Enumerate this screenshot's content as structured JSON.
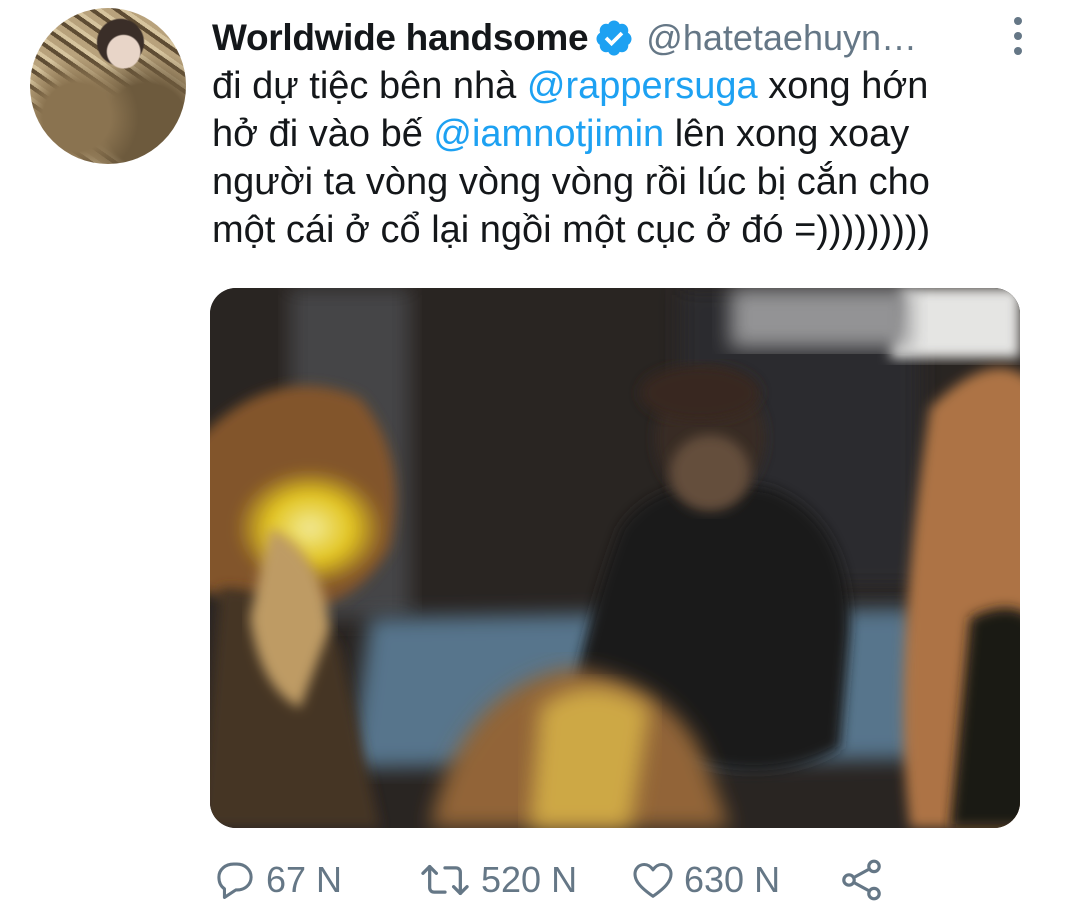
{
  "tweet": {
    "author": {
      "display_name": "Worldwide handsome",
      "handle": "@hatetaehuyn…",
      "verified": true
    },
    "text_lines": [
      [
        {
          "t": "đi dự tiệc bên nhà "
        },
        {
          "t": "@rappersuga",
          "mention": true
        },
        {
          "t": " xong hớn"
        }
      ],
      [
        {
          "t": "hở đi vào bế "
        },
        {
          "t": "@iamnotjimin",
          "mention": true
        },
        {
          "t": " lên xong xoay"
        }
      ],
      [
        {
          "t": "người ta vòng vòng vòng rồi lúc bị cắn cho"
        }
      ],
      [
        {
          "t": "một cái ở cổ lại ngồi một cục ở đó =)))))))))"
        }
      ]
    ],
    "actions": {
      "reply_count": "67 N",
      "retweet_count": "520 N",
      "like_count": "630 N"
    }
  },
  "icons": {
    "verified": "verified-badge-icon",
    "more": "more-vertical-icon",
    "reply": "reply-bubble-icon",
    "retweet": "retweet-icon",
    "like": "heart-icon",
    "share": "share-icon"
  },
  "colors": {
    "text": "#14171a",
    "secondary": "#657786",
    "mention": "#1da1f2",
    "verified": "#1da1f2",
    "background": "#ffffff"
  }
}
